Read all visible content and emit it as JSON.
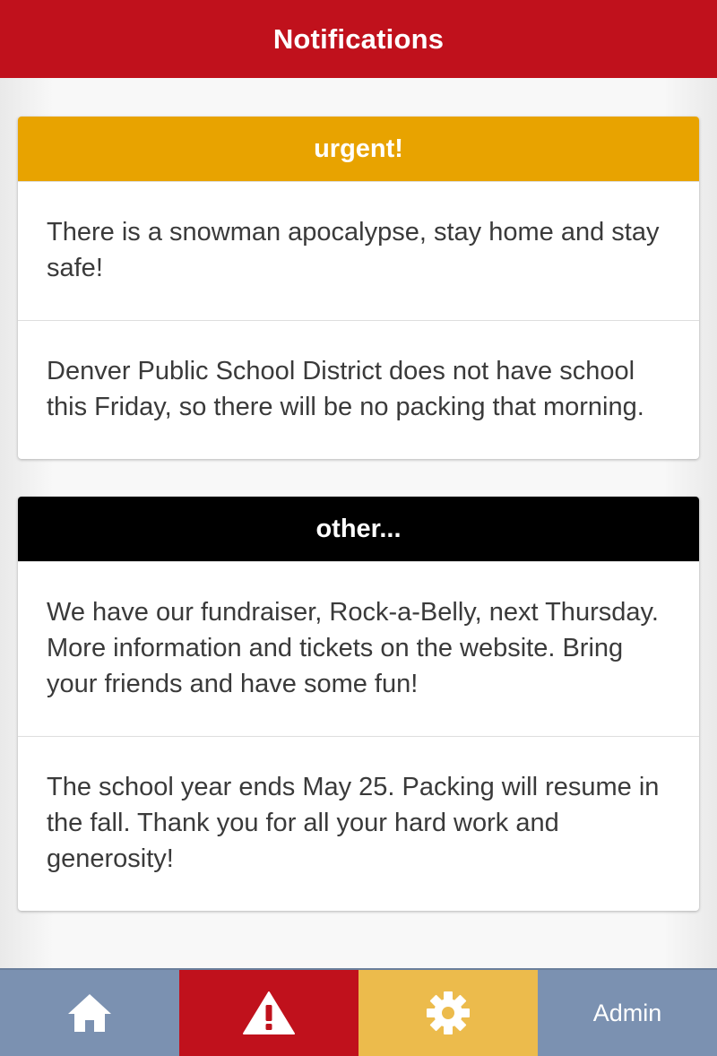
{
  "header": {
    "title": "Notifications"
  },
  "sections": [
    {
      "title": "urgent!",
      "color": "#e8a300",
      "items": [
        "There is a snowman apocalypse, stay home and stay safe!",
        "Denver Public School District does not have school this Friday, so there will be no packing that morning."
      ]
    },
    {
      "title": "other...",
      "color": "#000000",
      "items": [
        "We have our fundraiser, Rock-a-Belly, next Thursday. More information and tickets on the website. Bring your friends and have some fun!",
        "The school year ends May 25. Packing will resume in the fall. Thank you for all your hard work and generosity!"
      ]
    }
  ],
  "tabbar": {
    "tabs": [
      {
        "icon": "home-icon",
        "color": "#7b91b1",
        "active": false
      },
      {
        "icon": "alert-icon",
        "color": "#c0111c",
        "active": true
      },
      {
        "icon": "gear-icon",
        "color": "#ecbb4c",
        "active": false
      },
      {
        "label": "Admin",
        "color": "#7b91b1",
        "active": false
      }
    ]
  }
}
